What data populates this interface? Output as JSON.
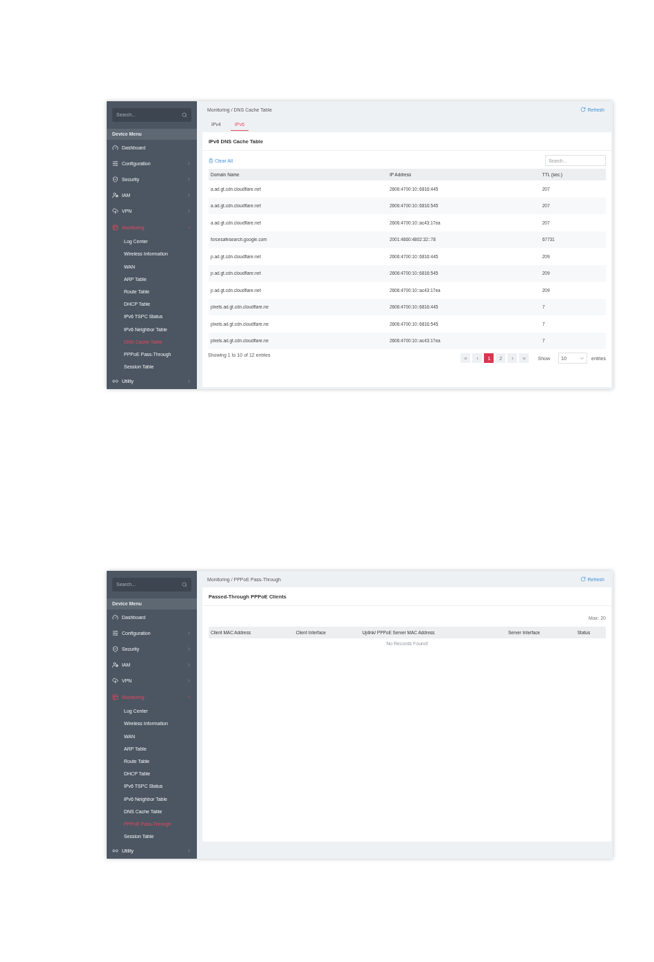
{
  "screens": [
    {
      "kind": "dns_table",
      "sidebar": {
        "search_placeholder": "Search...",
        "header": "Device Menu",
        "items": [
          {
            "label": "Dashboard",
            "kind": "link",
            "selected": false
          },
          {
            "label": "Configuration",
            "kind": "group",
            "expanded": false,
            "selected": false
          },
          {
            "label": "Security",
            "kind": "group",
            "expanded": false,
            "selected": false
          },
          {
            "label": "IAM",
            "kind": "group",
            "expanded": false,
            "selected": false
          },
          {
            "label": "VPN",
            "kind": "group",
            "expanded": false,
            "selected": false
          },
          {
            "label": "Monitoring",
            "kind": "group",
            "expanded": true,
            "selected": true,
            "children": [
              {
                "label": "Log Center",
                "selected": false
              },
              {
                "label": "Wireless Information",
                "selected": false
              },
              {
                "label": "WAN",
                "selected": false
              },
              {
                "label": "ARP Table",
                "selected": false
              },
              {
                "label": "Route Table",
                "selected": false
              },
              {
                "label": "DHCP Table",
                "selected": false
              },
              {
                "label": "IPv6 TSPC Status",
                "selected": false
              },
              {
                "label": "IPv6 Neighbor Table",
                "selected": false
              },
              {
                "label": "DNS Cache Table",
                "selected": true
              },
              {
                "label": "PPPoE Pass-Through",
                "selected": false
              },
              {
                "label": "Session Table",
                "selected": false
              }
            ]
          },
          {
            "label": "Utility",
            "kind": "group",
            "expanded": false,
            "selected": false
          }
        ]
      },
      "main": {
        "breadcrumb": "Monitoring / DNS Cache Table",
        "refresh": "Refresh",
        "tabs": [
          {
            "label": "IPv4",
            "selected": false
          },
          {
            "label": "IPv6",
            "selected": true
          }
        ],
        "card_title": "IPv6 DNS Cache Table",
        "clear_all": "Clear All",
        "search_placeholder": "Search...",
        "columns": [
          "Domain Name",
          "IP Address",
          "TTL (sec.)"
        ],
        "rows": [
          [
            "a.ad.gt.cdn.cloudflare.net",
            "2606:4700:10::6816:445",
            "207"
          ],
          [
            "a.ad.gt.cdn.cloudflare.net",
            "2606:4700:10::6816:545",
            "207"
          ],
          [
            "a.ad.gt.cdn.cloudflare.net",
            "2606:4700:10::ac43:17ea",
            "207"
          ],
          [
            "forcesafesearch.google.com",
            "2001:4860:4802:32::78",
            "67731"
          ],
          [
            "p.ad.gt.cdn.cloudflare.net",
            "2606:4700:10::6816:445",
            "209"
          ],
          [
            "p.ad.gt.cdn.cloudflare.net",
            "2606:4700:10::6816:545",
            "209"
          ],
          [
            "p.ad.gt.cdn.cloudflare.net",
            "2606:4700:10::ac43:17ea",
            "209"
          ],
          [
            "pixels.ad.gt.cdn.cloudflare.ne",
            "2606:4700:10::6816:445",
            "7"
          ],
          [
            "pixels.ad.gt.cdn.cloudflare.ne",
            "2606:4700:10::6816:545",
            "7"
          ],
          [
            "pixels.ad.gt.cdn.cloudflare.ne",
            "2606:4700:10::ac43:17ea",
            "7"
          ]
        ],
        "info": "Showing 1 to 10 of 12 entries",
        "pages": [
          {
            "label": "«",
            "selected": false
          },
          {
            "label": "‹",
            "selected": false
          },
          {
            "label": "1",
            "selected": true
          },
          {
            "label": "2",
            "selected": false
          },
          {
            "label": "›",
            "selected": false
          },
          {
            "label": "»",
            "selected": false
          }
        ],
        "show_label": "Show",
        "page_size": "10",
        "entries_label": "entries"
      }
    },
    {
      "kind": "pppoe",
      "sidebar": {
        "search_placeholder": "Search...",
        "header": "Device Menu",
        "items": [
          {
            "label": "Dashboard",
            "kind": "link",
            "selected": false
          },
          {
            "label": "Configuration",
            "kind": "group",
            "expanded": false,
            "selected": false
          },
          {
            "label": "Security",
            "kind": "group",
            "expanded": false,
            "selected": false
          },
          {
            "label": "IAM",
            "kind": "group",
            "expanded": false,
            "selected": false
          },
          {
            "label": "VPN",
            "kind": "group",
            "expanded": false,
            "selected": false
          },
          {
            "label": "Monitoring",
            "kind": "group",
            "expanded": true,
            "selected": true,
            "children": [
              {
                "label": "Log Center",
                "selected": false
              },
              {
                "label": "Wireless Information",
                "selected": false
              },
              {
                "label": "WAN",
                "selected": false
              },
              {
                "label": "ARP Table",
                "selected": false
              },
              {
                "label": "Route Table",
                "selected": false
              },
              {
                "label": "DHCP Table",
                "selected": false
              },
              {
                "label": "IPv6 TSPC Status",
                "selected": false
              },
              {
                "label": "IPv6 Neighbor Table",
                "selected": false
              },
              {
                "label": "DNS Cache Table",
                "selected": false
              },
              {
                "label": "PPPoE Pass-Through",
                "selected": true
              },
              {
                "label": "Session Table",
                "selected": false
              }
            ]
          },
          {
            "label": "Utility",
            "kind": "group",
            "expanded": false,
            "selected": false
          }
        ]
      },
      "main": {
        "breadcrumb": "Monitoring / PPPoE Pass-Through",
        "refresh": "Refresh",
        "card_title": "Passed-Through PPPoE Clients",
        "max": "Max: 20",
        "columns": [
          "Client MAC Address",
          "Client Interface",
          "Uplink/ PPPoE Server MAC Address",
          "Server Interface",
          "Status"
        ],
        "empty": "No Records Found!"
      }
    }
  ]
}
